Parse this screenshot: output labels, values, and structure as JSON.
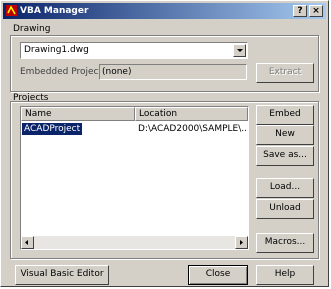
{
  "window": {
    "title": "VBA Manager",
    "help_button": "?",
    "close_button": "×"
  },
  "drawing": {
    "group_label": "Drawing",
    "selected": "Drawing1.dwg",
    "embedded_label": "Embedded Project:",
    "embedded_value": "(none)",
    "extract_button": "Extract"
  },
  "projects": {
    "group_label": "Projects",
    "columns": [
      "Name",
      "Location"
    ],
    "rows": [
      {
        "name": "ACADProject",
        "location": "D:\\ACAD2000\\SAMPLE\\..."
      }
    ]
  },
  "buttons": {
    "embed": "Embed",
    "new": "New",
    "save_as": "Save as...",
    "load": "Load...",
    "unload": "Unload",
    "macros": "Macros...",
    "visual_basic_editor": "Visual Basic Editor",
    "close": "Close",
    "help": "Help"
  },
  "colors": {
    "title_start": "#0a246a",
    "title_end": "#a6caf0",
    "selection": "#0a246a",
    "face": "#d4d0c8"
  },
  "icons": [
    "app-icon",
    "help-icon",
    "close-icon",
    "dropdown-arrow-icon",
    "scroll-left-icon",
    "scroll-right-icon"
  ]
}
